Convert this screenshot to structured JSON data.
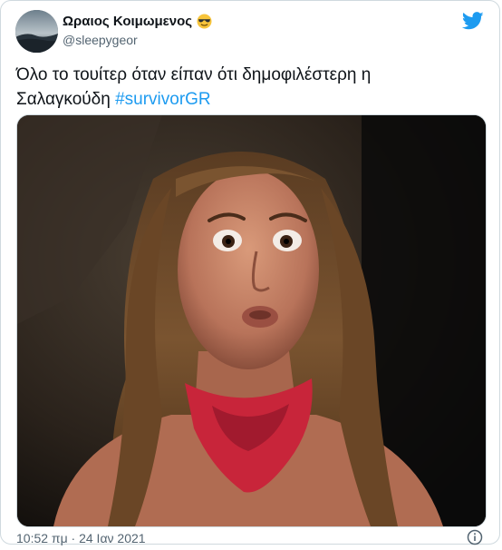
{
  "tweet": {
    "display_name": "Ωραιος Κοιμωμενος",
    "emoji": "smiling-face-with-sunglasses",
    "handle": "@sleepygeor",
    "text": "Όλο το τουίτερ όταν είπαν ότι δημοφιλέστερη η Σαλαγκούδη ",
    "hashtag": "#survivorGR",
    "timestamp": "10:52 πμ · 24 Ιαν 2021"
  },
  "icons": {
    "logo": "twitter-bird-icon",
    "info": "info-icon"
  },
  "colors": {
    "brand": "#1d9bf0",
    "text": "#0f1419",
    "muted": "#536471",
    "border": "#cfd9de"
  }
}
